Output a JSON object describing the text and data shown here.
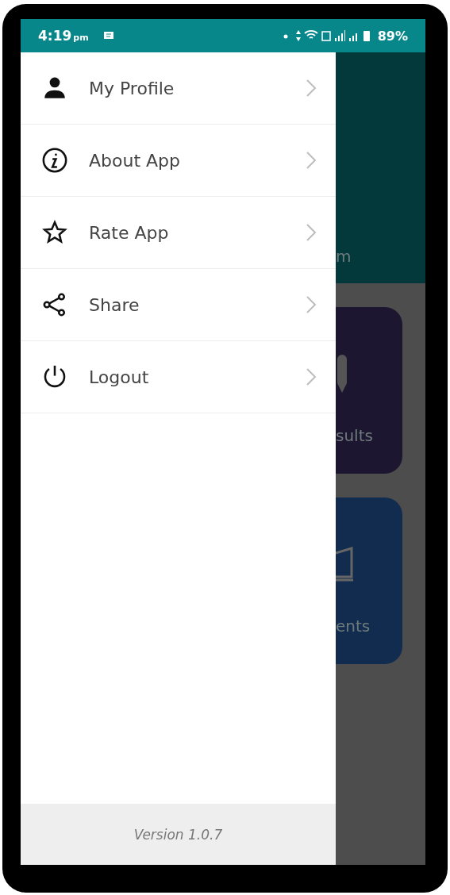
{
  "status_bar": {
    "time": "4:19",
    "meridiem": "pm",
    "battery": "89%"
  },
  "drawer": {
    "items": [
      {
        "kind": "person",
        "label": "My Profile"
      },
      {
        "kind": "info",
        "label": "About App"
      },
      {
        "kind": "star",
        "label": "Rate App"
      },
      {
        "kind": "share",
        "label": "Share"
      },
      {
        "kind": "power",
        "label": "Logout"
      }
    ],
    "footer": "Version 1.0.7"
  },
  "background": {
    "header_text": "m",
    "cards": [
      {
        "kind": "pen",
        "label": "sults",
        "color": "#1c1630"
      },
      {
        "kind": "book",
        "label": "ents",
        "color": "#112c4f"
      }
    ]
  }
}
